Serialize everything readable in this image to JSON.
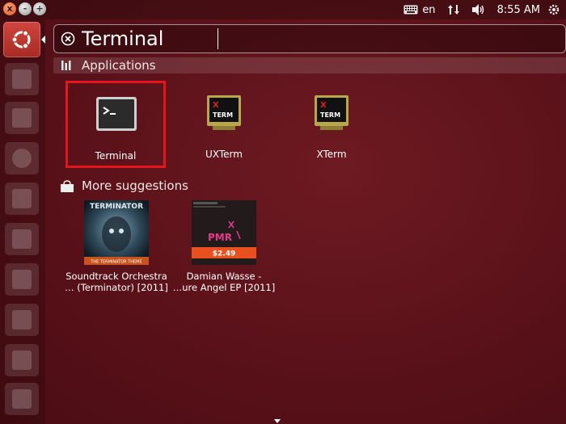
{
  "panel": {
    "keyboard_layout": "en",
    "clock": "8:55 AM"
  },
  "window_buttons": {
    "close": "x",
    "minimize": "-",
    "maximize": "+"
  },
  "search": {
    "query": "Terminal"
  },
  "applications": {
    "header": "Applications",
    "items": [
      {
        "label": "Terminal",
        "icon": "terminal-icon",
        "selected": true
      },
      {
        "label": "UXTerm",
        "icon": "xterm-icon"
      },
      {
        "label": "XTerm",
        "icon": "xterm-icon"
      }
    ]
  },
  "suggestions": {
    "header": "More suggestions",
    "items": [
      {
        "line1": "Soundtrack Orchestra",
        "line2": "… (Terminator) [2011]",
        "cover_title": "TERMINATOR",
        "cover_caption": "THE TERMINATOR THEME"
      },
      {
        "line1": "Damian Wasse -",
        "line2": "…ure Angel EP [2011]",
        "price": "$2.49",
        "cover_title": "PMR"
      }
    ]
  },
  "colors": {
    "background": "#5a1119",
    "selection_border": "#e5151c",
    "price_bar": "#e8501f"
  }
}
